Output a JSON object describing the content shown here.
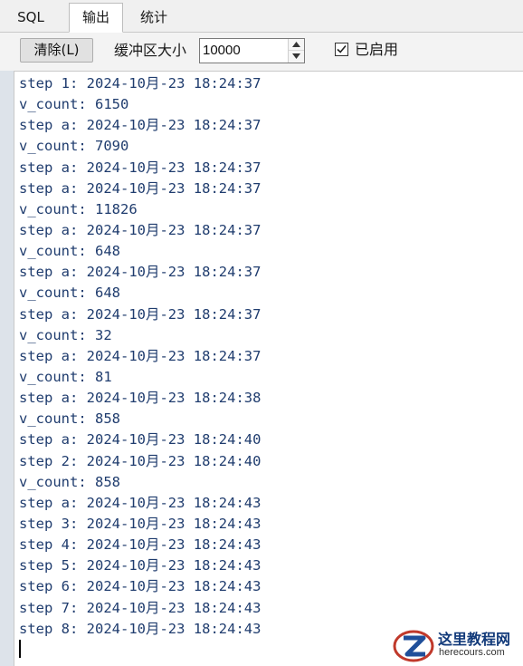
{
  "tabs": [
    {
      "label": "SQL",
      "active": false
    },
    {
      "label": "输出",
      "active": true
    },
    {
      "label": "统计",
      "active": false
    }
  ],
  "toolbar": {
    "clear_label": "清除(L)",
    "buffer_label": "缓冲区大小",
    "buffer_value": "10000",
    "enabled_label": "已启用",
    "enabled_checked": true
  },
  "output": {
    "lines": [
      "step 1: 2024-10月-23 18:24:37",
      "v_count: 6150",
      "step a: 2024-10月-23 18:24:37",
      "v_count: 7090",
      "step a: 2024-10月-23 18:24:37",
      "step a: 2024-10月-23 18:24:37",
      "v_count: 11826",
      "step a: 2024-10月-23 18:24:37",
      "v_count: 648",
      "step a: 2024-10月-23 18:24:37",
      "v_count: 648",
      "step a: 2024-10月-23 18:24:37",
      "v_count: 32",
      "step a: 2024-10月-23 18:24:37",
      "v_count: 81",
      "step a: 2024-10月-23 18:24:38",
      "v_count: 858",
      "step a: 2024-10月-23 18:24:40",
      "step 2: 2024-10月-23 18:24:40",
      "v_count: 858",
      "step a: 2024-10月-23 18:24:43",
      "step 3: 2024-10月-23 18:24:43",
      "step 4: 2024-10月-23 18:24:43",
      "step 5: 2024-10月-23 18:24:43",
      "step 6: 2024-10月-23 18:24:43",
      "step 7: 2024-10月-23 18:24:43",
      "step 8: 2024-10月-23 18:24:43"
    ]
  },
  "watermark": {
    "cn": "这里教程网",
    "en": "herecours.com"
  },
  "colors": {
    "output_text": "#1f3c6e",
    "panel_bg": "#f0f0f0",
    "accent_logo": "#c0392b"
  },
  "icons": {
    "spin_up": "chevron-up-icon",
    "spin_down": "chevron-down-icon",
    "checkbox": "check-icon",
    "logo": "z-logo-icon"
  }
}
